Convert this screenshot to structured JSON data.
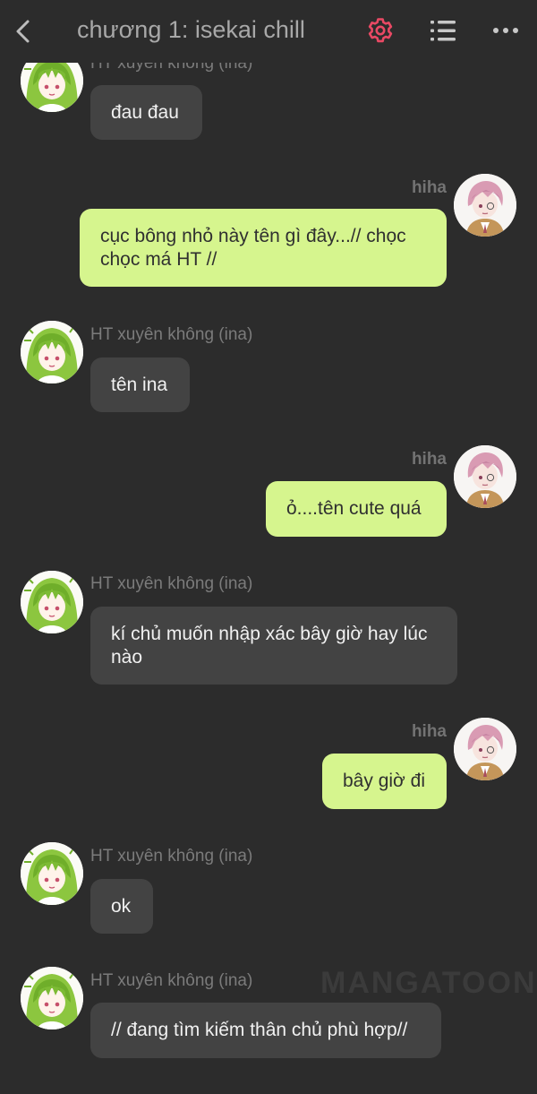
{
  "header": {
    "title": "chương 1: isekai chill",
    "back_icon": "chevron-left-icon",
    "settings_icon": "gear-icon",
    "list_icon": "list-icon",
    "more_icon": "more-horizontal-icon",
    "accent_color": "#e94964"
  },
  "colors": {
    "background": "#2c2c2c",
    "incoming_bubble": "#434343",
    "outgoing_bubble": "#d6f58e",
    "name_text": "#7b7b7b"
  },
  "watermark": "MANGATOON",
  "messages": [
    {
      "sender": "HT xuyên không (ina)",
      "side": "left",
      "text": "đau đau"
    },
    {
      "sender": "hiha",
      "side": "right",
      "text": "cục bông nhỏ này tên gì đây...// chọc chọc má HT //"
    },
    {
      "sender": "HT xuyên không (ina)",
      "side": "left",
      "text": "tên ina"
    },
    {
      "sender": "hiha",
      "side": "right",
      "text": "ỏ....tên cute quá"
    },
    {
      "sender": "HT xuyên không (ina)",
      "side": "left",
      "text": "kí chủ muốn nhập xác bây giờ hay lúc nào"
    },
    {
      "sender": "hiha",
      "side": "right",
      "text": "bây giờ đi"
    },
    {
      "sender": "HT xuyên không (ina)",
      "side": "left",
      "text": "ok"
    },
    {
      "sender": "HT xuyên không (ina)",
      "side": "left",
      "text": "// đang tìm kiếm thân chủ phù hợp//"
    }
  ]
}
